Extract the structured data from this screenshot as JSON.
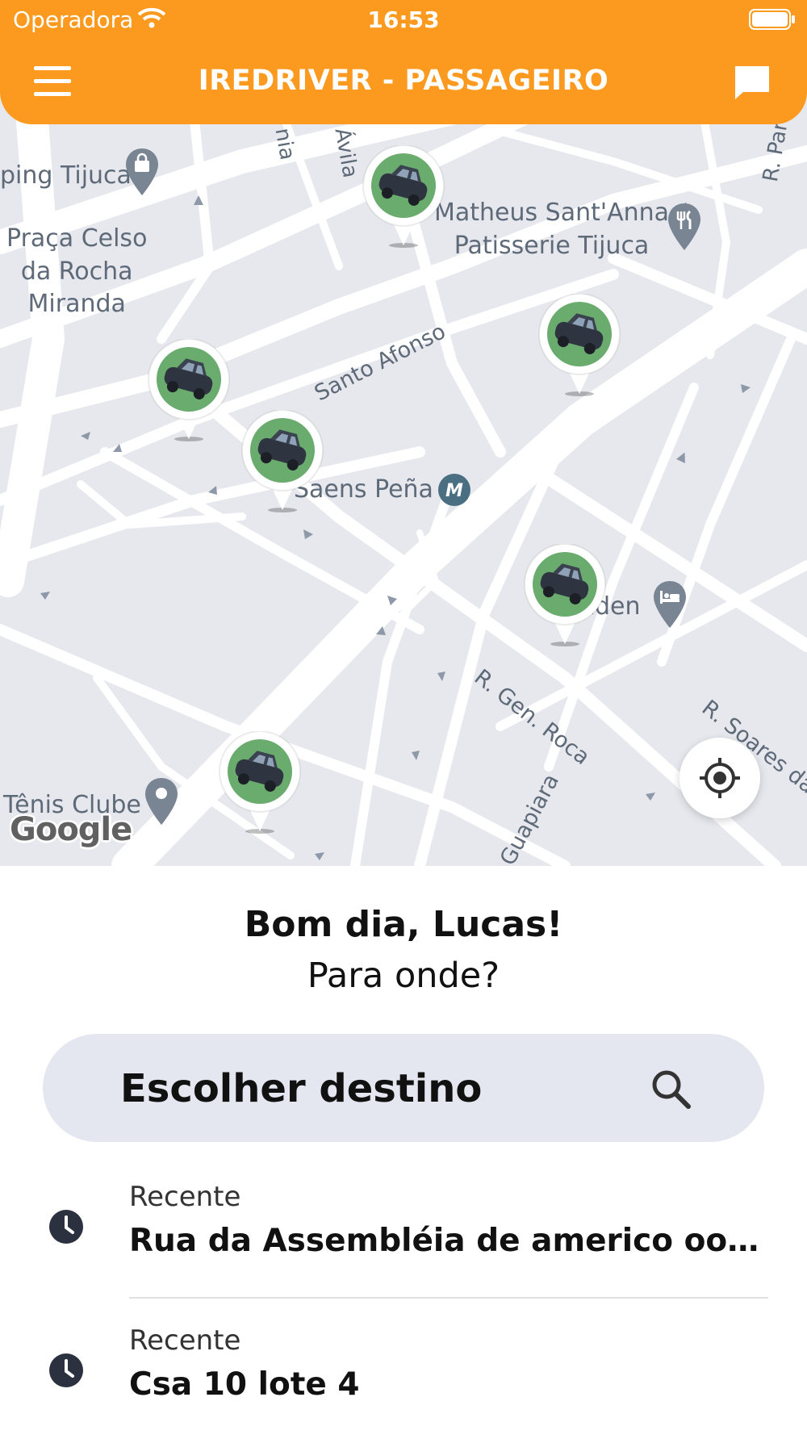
{
  "status_bar": {
    "carrier": "Operadora",
    "time": "16:53"
  },
  "header": {
    "title": "IREDRIVER - PASSAGEIRO"
  },
  "map": {
    "labels": {
      "shopping": "ping Tijuca",
      "praca": "Praça Celso\nda Rocha\nMiranda",
      "patisserie": "Matheus Sant'Anna\nPatisserie Tijuca",
      "santo_afonso": "Santo Afonso",
      "saens_pena": "Saens Peña",
      "hotel": "Eden",
      "gen_roca": "R. Gen. Roca",
      "soares": "R. Soares da",
      "guapiara": "Guapiara",
      "tenis": "Tênis Clube",
      "r_par": "R. Par",
      "avila": "Ávila",
      "nia": "nia"
    },
    "attribution": "Google"
  },
  "greeting": "Bom dia, Lucas!",
  "question": "Para onde?",
  "search": {
    "placeholder": "Escolher destino"
  },
  "recent": [
    {
      "type": "Recente",
      "address": "Rua da Assembléia de americo ooberlandia"
    },
    {
      "type": "Recente",
      "address": "Csa 10 lote 4"
    }
  ],
  "colors": {
    "header": "#fb9a1e",
    "map_bg": "#e6e8ee",
    "car_badge": "#6aab6e",
    "search_bg": "#e4e7f0"
  }
}
